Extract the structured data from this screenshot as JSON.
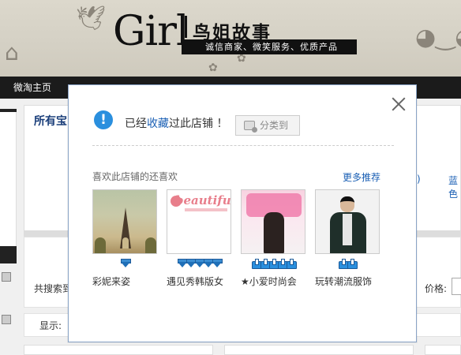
{
  "banner": {
    "brand_en": "Girl",
    "brand_cn": "鸟姐故事",
    "tagline": "诚信商家、微笑服务、优质产品"
  },
  "topnav": {
    "home": "微淘主页"
  },
  "background_page": {
    "all_items": "所有宝",
    "search_label": "共搜索到",
    "price_label": "价格:",
    "display_label": "显示:",
    "frag_paren": ")",
    "frag_blue": "蓝色"
  },
  "modal": {
    "message_prefix": "已经",
    "message_highlight": "收藏",
    "message_suffix": "过此店铺 ！",
    "categorize_button": "分类到",
    "section_title": "喜欢此店铺的还喜欢",
    "more_link": "更多推荐",
    "shops": [
      {
        "name": "彩妮来姿",
        "rank_icon": "diamond",
        "rank_count": 1
      },
      {
        "name": "遇见秀韩版女",
        "rank_icon": "diamond",
        "rank_count": 5
      },
      {
        "name": "★小爱时尚会",
        "rank_icon": "crown",
        "rank_count": 5
      },
      {
        "name": "玩转潮流服饰",
        "rank_icon": "crown",
        "rank_count": 2
      }
    ],
    "thumb2_logo": "beautiful"
  },
  "colors": {
    "accent_blue": "#1a5fb4",
    "info_icon": "#2a8fde",
    "topnav_bg": "#1b1b1b"
  }
}
